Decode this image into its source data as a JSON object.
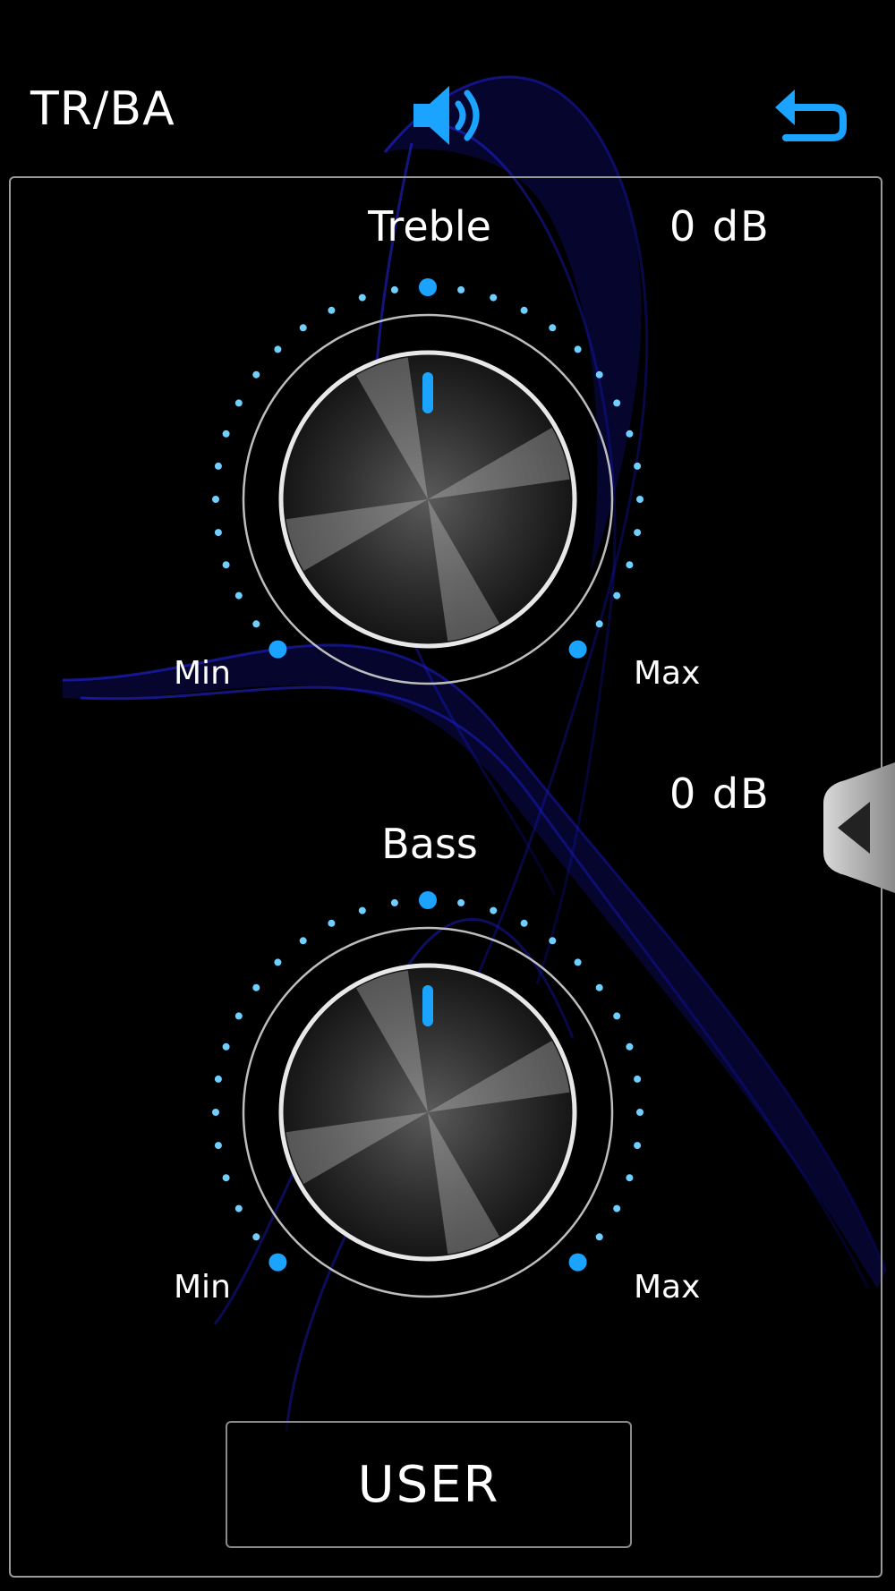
{
  "header": {
    "title": "TR/BA",
    "speaker_icon": "speaker-volume-icon",
    "back_icon": "back-arrow-icon",
    "accent_color": "#1aa3ff"
  },
  "treble": {
    "label": "Treble",
    "value_text": "0  dB",
    "min_label": "Min",
    "max_label": "Max",
    "level": 0.5
  },
  "bass": {
    "label": "Bass",
    "value_text": "0  dB",
    "min_label": "Min",
    "max_label": "Max",
    "level": 0.5
  },
  "side_tab": {
    "icon": "chevron-left-icon"
  },
  "user_button": {
    "label": "USER"
  }
}
